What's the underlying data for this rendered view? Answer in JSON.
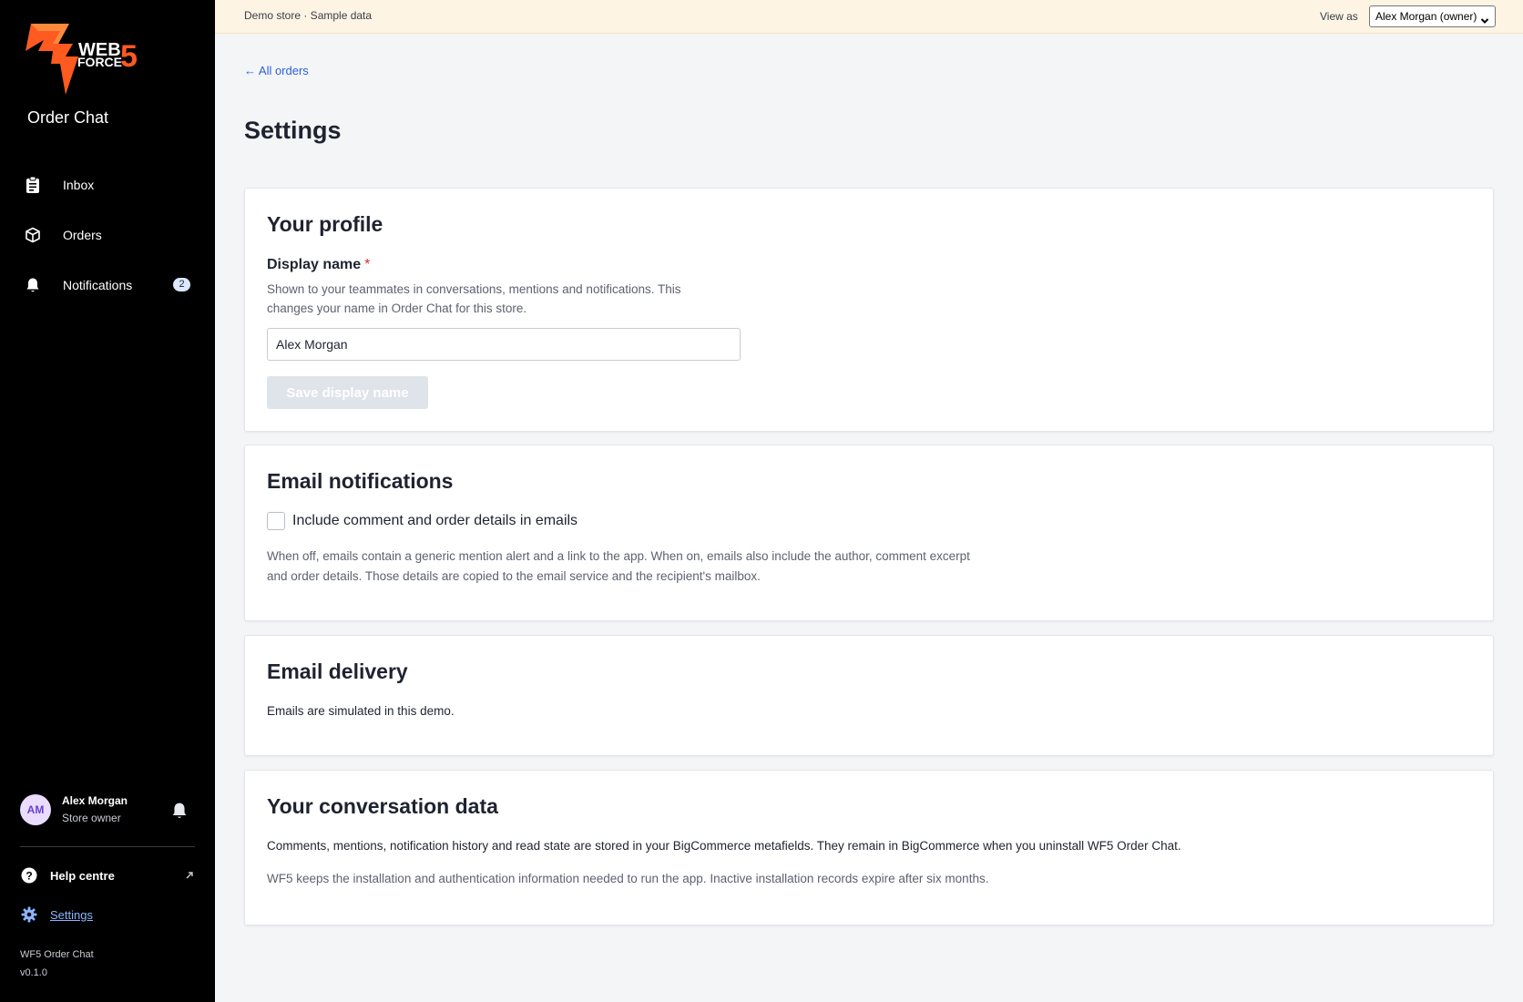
{
  "brand": {
    "logo_line1": "WEB",
    "logo_line2": "FORCE",
    "logo_number": "5",
    "accent_color": "#ff5a1f",
    "app_name": "Order Chat"
  },
  "sidebar": {
    "nav": [
      {
        "label": "Inbox",
        "icon": "clipboard-icon"
      },
      {
        "label": "Orders",
        "icon": "box-icon"
      },
      {
        "label": "Notifications",
        "icon": "bell-icon",
        "badge": "2"
      }
    ],
    "user": {
      "initials": "AM",
      "name": "Alex Morgan",
      "role": "Store owner"
    },
    "help_label": "Help centre",
    "settings_label": "Settings",
    "version_name": "WF5 Order Chat",
    "version_number": "v0.1.0"
  },
  "banner": {
    "text": "Demo store · Sample data",
    "view_as_label": "View as",
    "view_as_value": "Alex Morgan (owner)"
  },
  "main": {
    "back_link": "← All orders",
    "title": "Settings",
    "profile": {
      "title": "Your profile",
      "field_label": "Display name",
      "required_mark": "*",
      "help": "Shown to your teammates in conversations, mentions and notifications. This changes your name in Order Chat for this store.",
      "value": "Alex Morgan",
      "save_label": "Save display name"
    },
    "email_notifications": {
      "title": "Email notifications",
      "checkbox_label": "Include comment and order details in emails",
      "checked": false,
      "help": "When off, emails contain a generic mention alert and a link to the app. When on, emails also include the author, comment excerpt and order details. Those details are copied to the email service and the recipient's mailbox."
    },
    "email_delivery": {
      "title": "Email delivery",
      "text": "Emails are simulated in this demo."
    },
    "conversation_data": {
      "title": "Your conversation data",
      "text": "Comments, mentions, notification history and read state are stored in your BigCommerce metafields. They remain in BigCommerce when you uninstall WF5 Order Chat.",
      "muted": "WF5 keeps the installation and authentication information needed to run the app. Inactive installation records expire after six months."
    }
  }
}
